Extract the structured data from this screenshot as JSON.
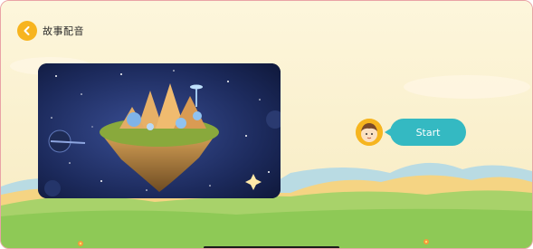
{
  "header": {
    "title": "故事配音",
    "back_icon": "back-arrow-icon"
  },
  "cta": {
    "start_label": "Start",
    "button_color": "#34b9c2",
    "avatar_icon": "kid-avatar-icon"
  },
  "story": {
    "image_icon": "floating-island-space-illustration"
  },
  "colors": {
    "accent": "#f7b41f",
    "background": "#fdf3d8",
    "grass": "#8ec956"
  }
}
